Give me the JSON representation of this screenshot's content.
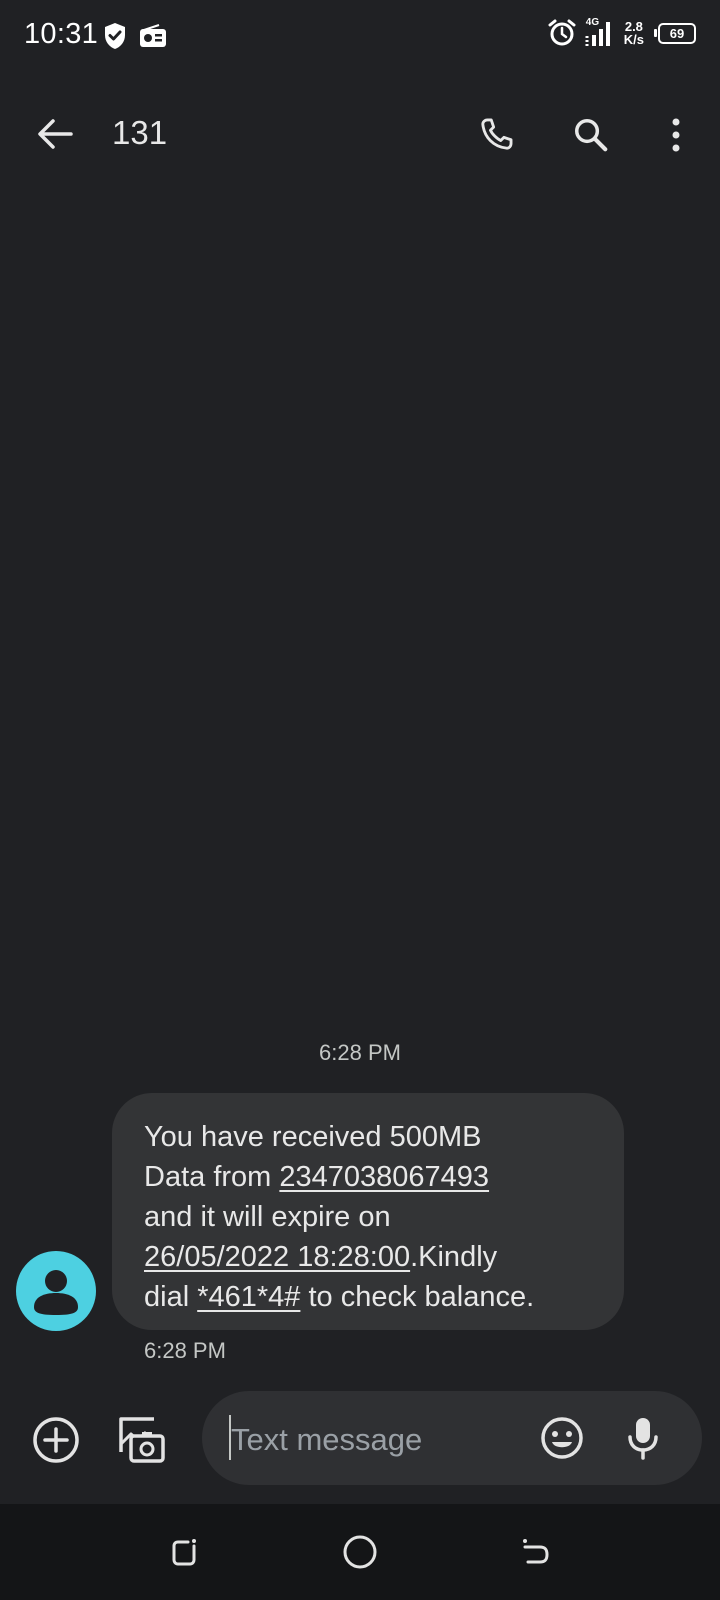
{
  "status_bar": {
    "time": "10:31",
    "network_type": "4G",
    "speed_value": "2.8",
    "speed_unit": "K/s",
    "battery_level": "69",
    "icons": [
      "shield-check-icon",
      "radio-icon",
      "alarm-icon",
      "signal-icon",
      "battery-icon"
    ]
  },
  "header": {
    "title": "131",
    "icons": [
      "back-arrow-icon",
      "phone-icon",
      "search-icon",
      "more-vert-icon"
    ]
  },
  "conversation": {
    "date_separator": "6:28 PM",
    "message": {
      "text_1": "You have received 500MB",
      "text_2": "Data from ",
      "link_phone": "2347038067493",
      "text_3": "and it will expire on",
      "link_datetime": "26/05/2022 18:28:00",
      "text_4": ".Kindly",
      "text_5": "dial ",
      "link_ussd": "*461*4#",
      "text_6": " to check balance.",
      "time": "6:28 PM"
    }
  },
  "composer": {
    "placeholder": "Text message",
    "icons": [
      "add-circle-icon",
      "gallery-icon",
      "emoji-icon",
      "mic-icon"
    ]
  },
  "nav_bar": {
    "icons": [
      "recents-icon",
      "home-icon",
      "back-icon"
    ]
  },
  "colors": {
    "background": "#202124",
    "bubble": "#333436",
    "avatar": "#4dd0e1",
    "compose_field": "#2f3033",
    "nav_bar": "#141517"
  }
}
